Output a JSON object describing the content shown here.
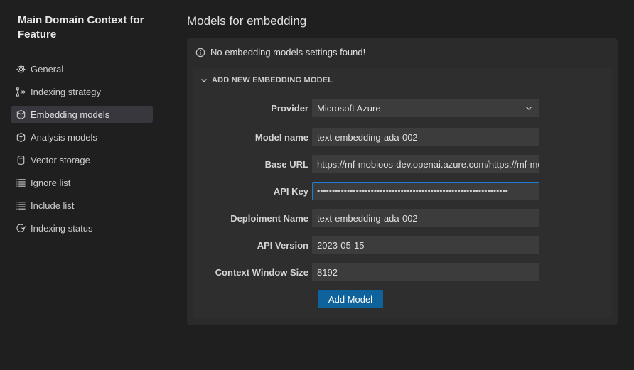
{
  "sidebar": {
    "title": "Main Domain Context for Feature",
    "items": [
      {
        "label": "General",
        "icon": "gear-icon",
        "active": false
      },
      {
        "label": "Indexing strategy",
        "icon": "strategy-icon",
        "active": false
      },
      {
        "label": "Embedding models",
        "icon": "cube-icon",
        "active": true
      },
      {
        "label": "Analysis models",
        "icon": "cube-icon",
        "active": false
      },
      {
        "label": "Vector storage",
        "icon": "database-icon",
        "active": false
      },
      {
        "label": "Ignore list",
        "icon": "list-icon",
        "active": false
      },
      {
        "label": "Include list",
        "icon": "list-icon",
        "active": false
      },
      {
        "label": "Indexing status",
        "icon": "status-icon",
        "active": false
      }
    ]
  },
  "main": {
    "title": "Models for embedding",
    "notice": "No embedding models settings found!",
    "section_header": "ADD NEW EMBEDDING MODEL",
    "form": {
      "provider_label": "Provider",
      "provider_value": "Microsoft Azure",
      "model_name_label": "Model name",
      "model_name_value": "text-embedding-ada-002",
      "base_url_label": "Base URL",
      "base_url_value": "https://mf-mobioos-dev.openai.azure.com/https://mf-mobioos-dev.openai.azure.com/",
      "api_key_label": "API Key",
      "api_key_value": "••••••••••••••••••••••••••••••••••••••••••••••••••••••••••••••••",
      "deployment_name_label": "Deploiment Name",
      "deployment_name_value": "text-embedding-ada-002",
      "api_version_label": "API Version",
      "api_version_value": "2023-05-15",
      "context_window_label": "Context Window Size",
      "context_window_value": "8192"
    },
    "add_button": "Add Model"
  },
  "colors": {
    "background": "#1f1f1f",
    "panel": "#2b2b2b",
    "accent": "#0e639c",
    "focus_border": "#1f7dd6",
    "active_nav": "#37373d"
  }
}
